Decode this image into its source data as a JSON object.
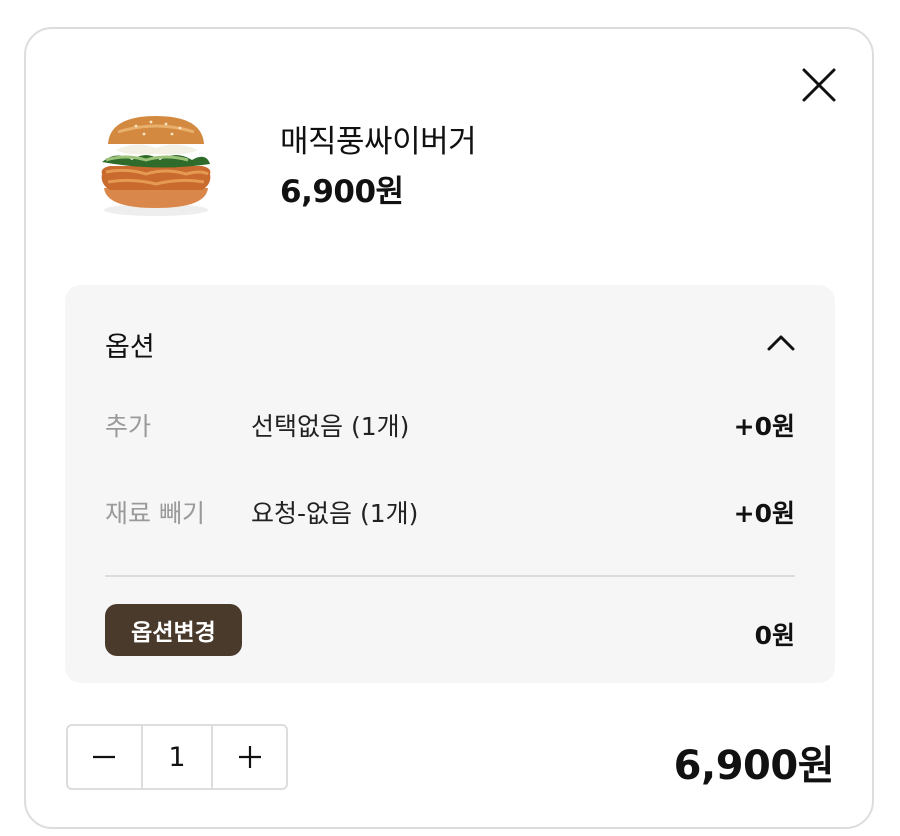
{
  "product": {
    "name": "매직풍싸이버거",
    "price": "6,900원",
    "image_icon": "burger-image"
  },
  "options": {
    "title": "옵션",
    "expanded": true,
    "rows": [
      {
        "label": "추가",
        "value": "선택없음 (1개)",
        "price": "+0원"
      },
      {
        "label": "재료 빼기",
        "value": "요청-없음 (1개)",
        "price": "+0원"
      }
    ],
    "change_button_label": "옵션변경",
    "options_total": "0원"
  },
  "quantity": {
    "value": "1",
    "minus_icon": "minus-icon",
    "plus_icon": "plus-icon"
  },
  "total": "6,900원",
  "colors": {
    "change_button_bg": "#4a3a2c",
    "panel_bg": "#f6f6f6",
    "label_gray": "#9a9a9a"
  }
}
